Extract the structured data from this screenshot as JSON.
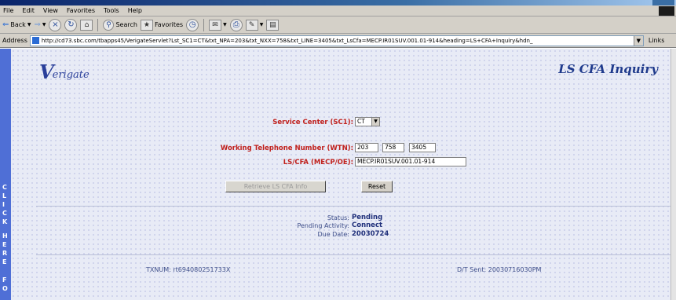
{
  "menu": [
    "File",
    "Edit",
    "View",
    "Favorites",
    "Tools",
    "Help"
  ],
  "toolbar": {
    "back": "Back",
    "search": "Search",
    "favorites": "Favorites"
  },
  "address": {
    "label": "Address",
    "url": "http://cd73.sbc.com/tbapps45/VerigateServlet?Lst_SC1=CT&txt_NPA=203&txt_NXX=758&txt_LINE=3405&txt_LsCfa=MECP.IR01SUV.001.01-914&heading=LS+CFA+Inquiry&hdn_",
    "links": "Links"
  },
  "side_text": [
    "C",
    "L",
    "I",
    "C",
    "K",
    "H",
    "E",
    "R",
    "E",
    "F",
    "O"
  ],
  "header": {
    "logo_initial": "V",
    "logo_rest": "erigate",
    "page_title": "LS CFA Inquiry"
  },
  "form": {
    "service_center_label": "Service Center (SC1):",
    "service_center_value": "CT",
    "wtn_label": "Working Telephone Number (WTN):",
    "wtn_npa": "203",
    "wtn_nxx": "758",
    "wtn_line": "3405",
    "lscfa_label": "LS/CFA (MECP/OE):",
    "lscfa_value": "MECP.IR01SUV.001.01-914",
    "retrieve_label": "Retrieve LS CFA Info",
    "reset_label": "Reset"
  },
  "status": {
    "status_label": "Status:",
    "status_value": "Pending",
    "activity_label": "Pending Activity:",
    "activity_value": "Connect",
    "due_label": "Due Date:",
    "due_value": "20030724"
  },
  "footer": {
    "txnum": "TXNUM: rt694080251733X",
    "dt_sent": "D/T Sent: 20030716030PM"
  }
}
